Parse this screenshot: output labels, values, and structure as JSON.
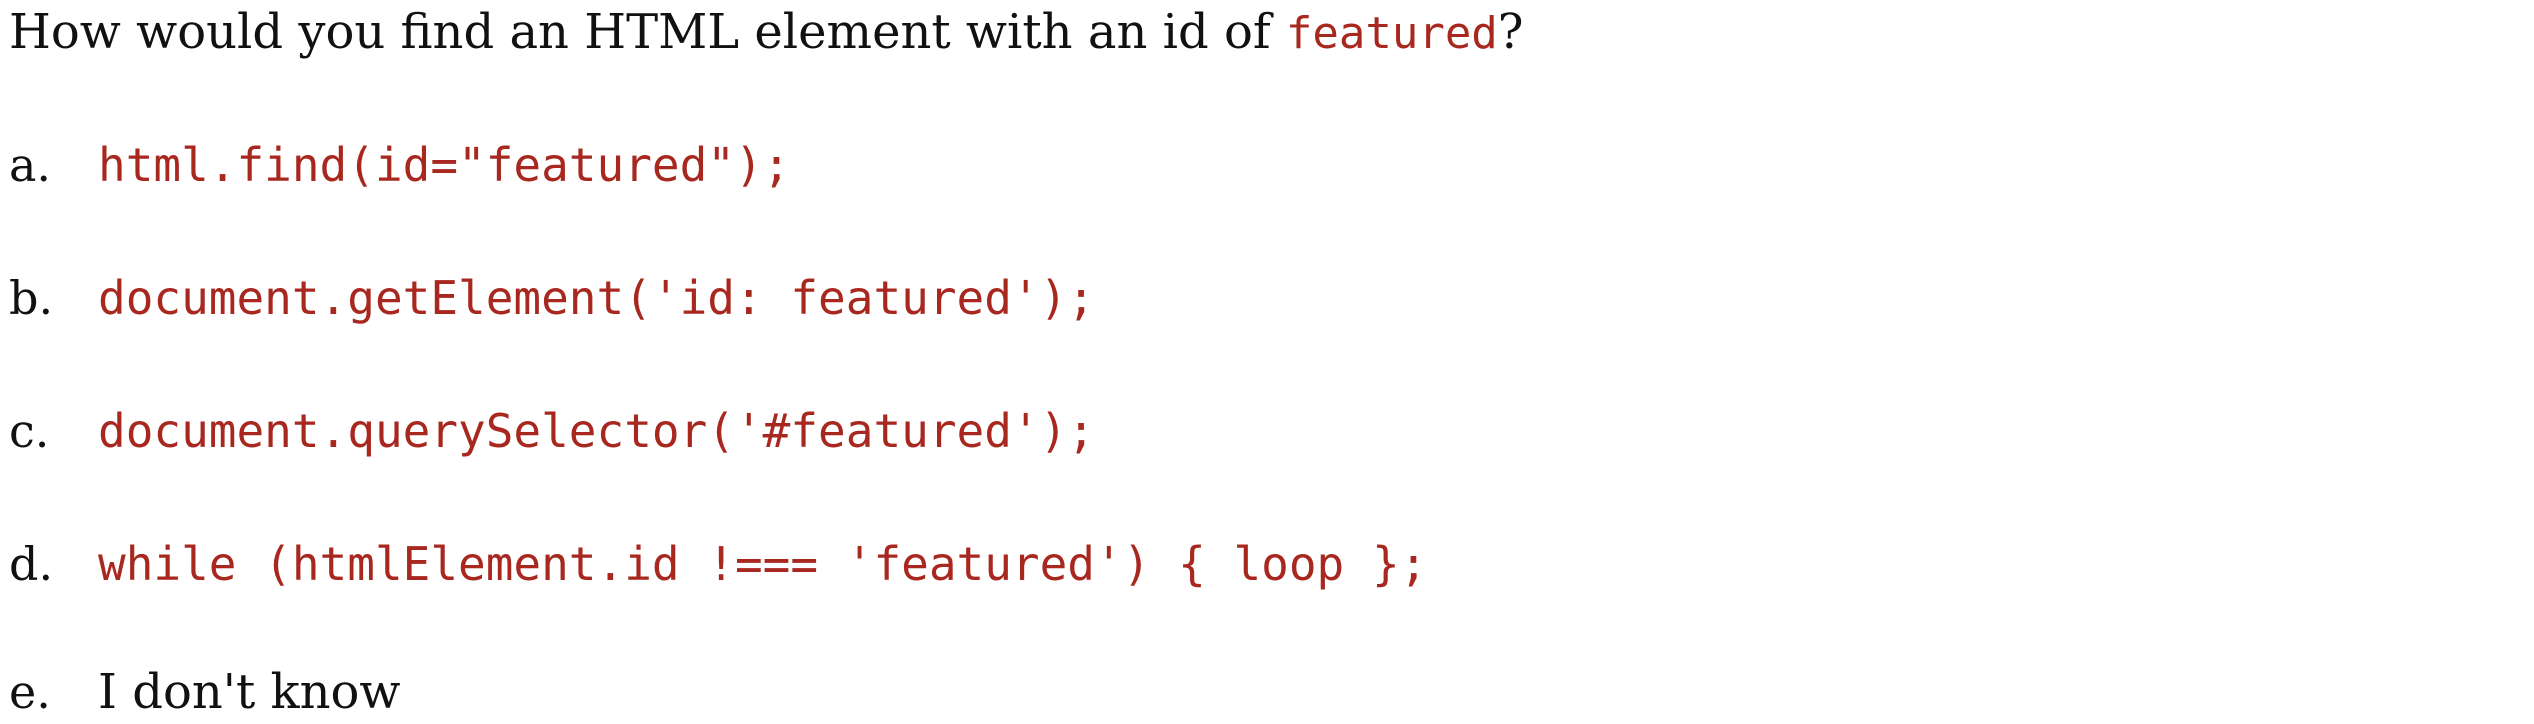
{
  "question": {
    "text_before": "How would you find an HTML element with an id of ",
    "code": "featured",
    "text_after": "?"
  },
  "options": [
    {
      "letter": "a.",
      "text": "html.find(id=\"featured\");",
      "is_code": true
    },
    {
      "letter": "b.",
      "text": "document.getElement('id: featured');",
      "is_code": true
    },
    {
      "letter": "c.",
      "text": "document.querySelector('#featured');",
      "is_code": true
    },
    {
      "letter": "d.",
      "text": "while (htmlElement.id !=== 'featured') { loop };",
      "is_code": true
    },
    {
      "letter": "e.",
      "text": "I don't know",
      "is_code": false
    }
  ],
  "colors": {
    "code": "#a8271f",
    "text": "#111111",
    "background": "#ffffff"
  }
}
